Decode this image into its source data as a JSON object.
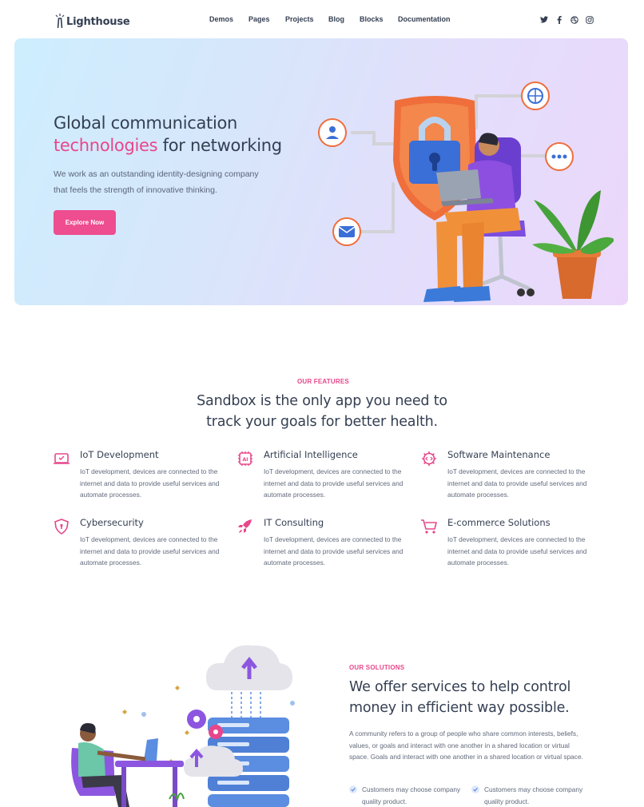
{
  "brand": {
    "name": "Lighthouse"
  },
  "nav": {
    "links": [
      "Demos",
      "Pages",
      "Projects",
      "Blog",
      "Blocks",
      "Documentation"
    ],
    "social": [
      "twitter-icon",
      "facebook-icon",
      "dribbble-icon",
      "instagram-icon"
    ]
  },
  "hero": {
    "title_line1": "Global communication",
    "title_accent": "technologies",
    "title_rest": " for networking",
    "subtitle": "We work as an outstanding identity-designing company that feels the strength of innovative thinking.",
    "cta": "Explore Now"
  },
  "features": {
    "eyebrow": "Our Features",
    "title_line1": "Sandbox is the only app you need to",
    "title_line2": "track your goals for better health.",
    "items": [
      {
        "title": "IoT Development",
        "icon": "laptop-icon",
        "desc": "IoT development, devices are connected to the internet and data to provide useful services and automate processes."
      },
      {
        "title": "Artificial Intelligence",
        "icon": "ai-chip-icon",
        "desc": "IoT development, devices are connected to the internet and data to provide useful services and automate processes."
      },
      {
        "title": "Software Maintenance",
        "icon": "code-gear-icon",
        "desc": "IoT development, devices are connected to the internet and data to provide useful services and automate processes."
      },
      {
        "title": "Cybersecurity",
        "icon": "shield-icon",
        "desc": "IoT development, devices are connected to the internet and data to provide useful services and automate processes."
      },
      {
        "title": "IT Consulting",
        "icon": "rocket-icon",
        "desc": "IoT development, devices are connected to the internet and data to provide useful services and automate processes."
      },
      {
        "title": "E-commerce Solutions",
        "icon": "cart-icon",
        "desc": "IoT development, devices are connected to the internet and data to provide useful services and automate processes."
      }
    ]
  },
  "solutions": {
    "eyebrow": "Our Solutions",
    "title_line1": "We offer services to help control",
    "title_line2": "money in efficient way possible.",
    "body": "A community refers to a group of people who share common interests, beliefs, values, or goals and interact with one another in a shared location or virtual space. Goals and interact with one another in a shared location or virtual space.",
    "checklist": [
      "Customers may choose company quality product.",
      "Customers may choose company quality product."
    ]
  },
  "colors": {
    "accent": "#e8468b",
    "text": "#343f52",
    "muted": "#60697b"
  }
}
